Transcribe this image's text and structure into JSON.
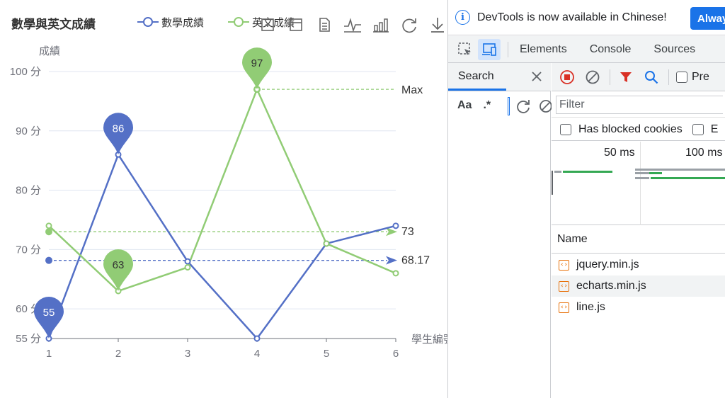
{
  "chart": {
    "title": "數學與英文成績",
    "legend": [
      {
        "name": "數學成績",
        "color": "#5470c6"
      },
      {
        "name": "英文成績",
        "color": "#91cc75"
      }
    ],
    "toolbox": [
      "zoom-in-icon",
      "zoom-reset-icon",
      "data-view-icon",
      "line-chart-icon",
      "bar-chart-icon",
      "restore-icon",
      "download-icon"
    ]
  },
  "chart_data": {
    "type": "line",
    "title": "數學與英文成績",
    "categories": [
      "1",
      "2",
      "3",
      "4",
      "5",
      "6"
    ],
    "xlabel": "學生編號",
    "ylabel": "成績",
    "ylim": [
      55,
      100
    ],
    "y_ticks": [
      {
        "value": 55,
        "label": "55 分"
      },
      {
        "value": 60,
        "label": "60 分"
      },
      {
        "value": 70,
        "label": "70 分"
      },
      {
        "value": 80,
        "label": "80 分"
      },
      {
        "value": 90,
        "label": "90 分"
      },
      {
        "value": 100,
        "label": "100 分"
      }
    ],
    "grid": true,
    "series": [
      {
        "name": "數學成績",
        "color": "#5470c6",
        "values": [
          55,
          86,
          68,
          55,
          71,
          74
        ],
        "mark_points": [
          {
            "index": 0,
            "value": 55,
            "label": "55"
          },
          {
            "index": 1,
            "value": 86,
            "label": "86"
          }
        ],
        "mark_line": {
          "type": "average",
          "value": 68.17,
          "label": "68.17"
        }
      },
      {
        "name": "英文成績",
        "color": "#91cc75",
        "values": [
          74,
          63,
          67,
          97,
          71,
          66
        ],
        "mark_points": [
          {
            "index": 3,
            "value": 97,
            "label": "97"
          },
          {
            "index": 1,
            "value": 63,
            "label": "63"
          }
        ],
        "mark_line_avg": {
          "value": 73,
          "label": "73"
        },
        "mark_line_max": {
          "value": 97,
          "label": "Max"
        }
      }
    ]
  },
  "devtools": {
    "infobar": {
      "message": "DevTools is now available in Chinese!",
      "button": "Always"
    },
    "tabs": [
      "Elements",
      "Console",
      "Sources"
    ],
    "search": {
      "tab_label": "Search",
      "case_option": "Aa",
      "regex_option": ".*"
    },
    "network": {
      "preserve_label": "Pre",
      "filter_placeholder": "Filter",
      "blocked_cookies_label": "Has blocked cookies",
      "second_checkbox_label": "E",
      "timeline_labels": [
        "50 ms",
        "100 ms"
      ],
      "name_header": "Name",
      "files": [
        "jquery.min.js",
        "echarts.min.js",
        "line.js"
      ]
    }
  }
}
